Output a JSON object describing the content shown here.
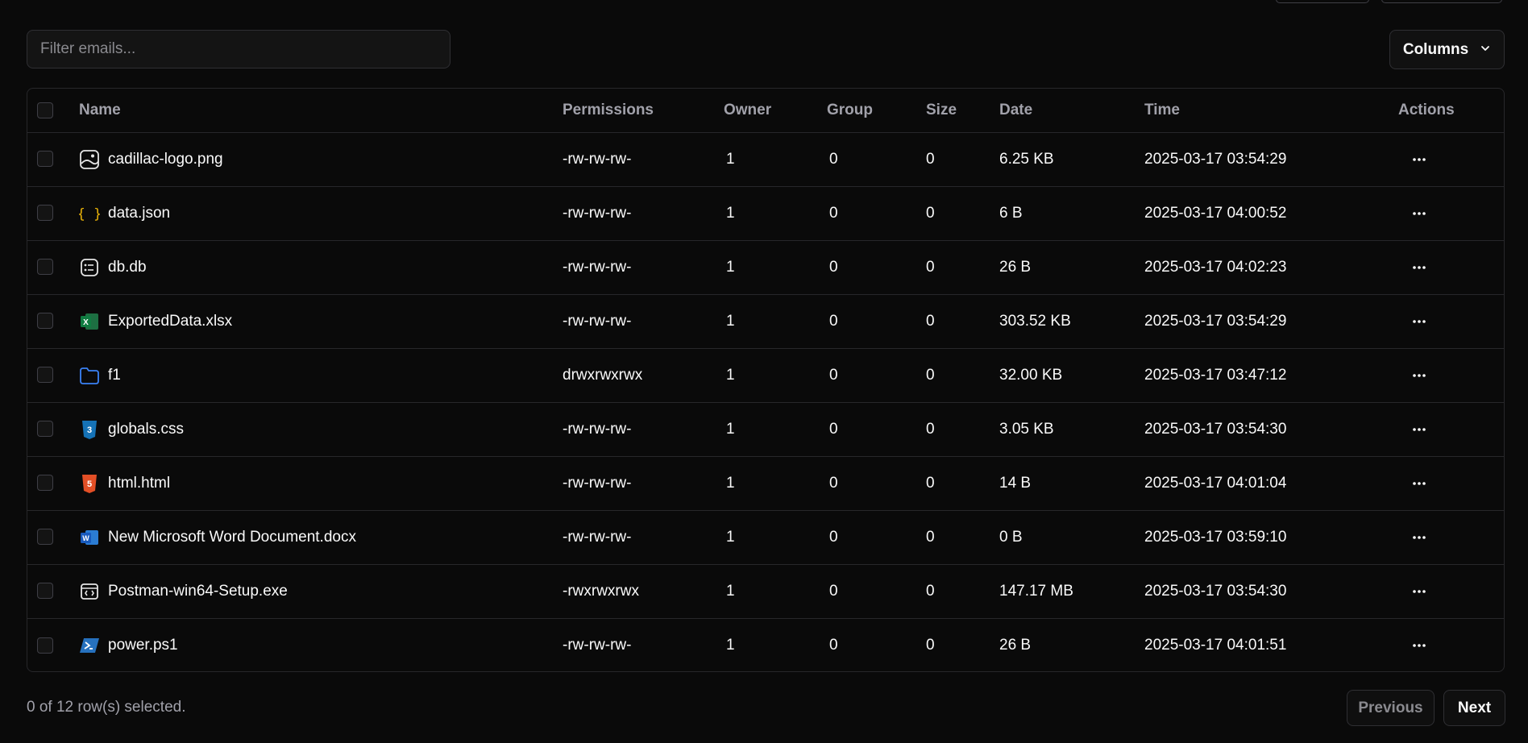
{
  "filter": {
    "placeholder": "Filter emails..."
  },
  "columns_button": {
    "label": "Columns"
  },
  "table": {
    "headers": {
      "name": "Name",
      "permissions": "Permissions",
      "owner": "Owner",
      "group": "Group",
      "size": "Size",
      "date": "Date",
      "time": "Time",
      "actions": "Actions"
    },
    "rows": [
      {
        "name": "cadillac-logo.png",
        "icon": "image-file-icon",
        "permissions": "-rw-rw-rw-",
        "owner": "1",
        "group": "0",
        "size": "0",
        "date": "6.25 KB",
        "time": "2025-03-17 03:54:29"
      },
      {
        "name": "data.json",
        "icon": "json-file-icon",
        "permissions": "-rw-rw-rw-",
        "owner": "1",
        "group": "0",
        "size": "0",
        "date": "6 B",
        "time": "2025-03-17 04:00:52"
      },
      {
        "name": "db.db",
        "icon": "database-file-icon",
        "permissions": "-rw-rw-rw-",
        "owner": "1",
        "group": "0",
        "size": "0",
        "date": "26 B",
        "time": "2025-03-17 04:02:23"
      },
      {
        "name": "ExportedData.xlsx",
        "icon": "excel-file-icon",
        "permissions": "-rw-rw-rw-",
        "owner": "1",
        "group": "0",
        "size": "0",
        "date": "303.52 KB",
        "time": "2025-03-17 03:54:29"
      },
      {
        "name": "f1",
        "icon": "folder-icon",
        "permissions": "drwxrwxrwx",
        "owner": "1",
        "group": "0",
        "size": "0",
        "date": "32.00 KB",
        "time": "2025-03-17 03:47:12"
      },
      {
        "name": "globals.css",
        "icon": "css-file-icon",
        "permissions": "-rw-rw-rw-",
        "owner": "1",
        "group": "0",
        "size": "0",
        "date": "3.05 KB",
        "time": "2025-03-17 03:54:30"
      },
      {
        "name": "html.html",
        "icon": "html-file-icon",
        "permissions": "-rw-rw-rw-",
        "owner": "1",
        "group": "0",
        "size": "0",
        "date": "14 B",
        "time": "2025-03-17 04:01:04"
      },
      {
        "name": "New Microsoft Word Document.docx",
        "icon": "word-file-icon",
        "permissions": "-rw-rw-rw-",
        "owner": "1",
        "group": "0",
        "size": "0",
        "date": "0 B",
        "time": "2025-03-17 03:59:10"
      },
      {
        "name": "Postman-win64-Setup.exe",
        "icon": "executable-file-icon",
        "permissions": "-rwxrwxrwx",
        "owner": "1",
        "group": "0",
        "size": "0",
        "date": "147.17 MB",
        "time": "2025-03-17 03:54:30"
      },
      {
        "name": "power.ps1",
        "icon": "powershell-file-icon",
        "permissions": "-rw-rw-rw-",
        "owner": "1",
        "group": "0",
        "size": "0",
        "date": "26 B",
        "time": "2025-03-17 04:01:51"
      }
    ]
  },
  "footer": {
    "selection": "0 of 12 row(s) selected.",
    "previous_label": "Previous",
    "next_label": "Next"
  },
  "colors": {
    "background": "#0a0a0a",
    "border": "#27272a",
    "text": "#fafafa",
    "muted": "#a1a1aa"
  }
}
